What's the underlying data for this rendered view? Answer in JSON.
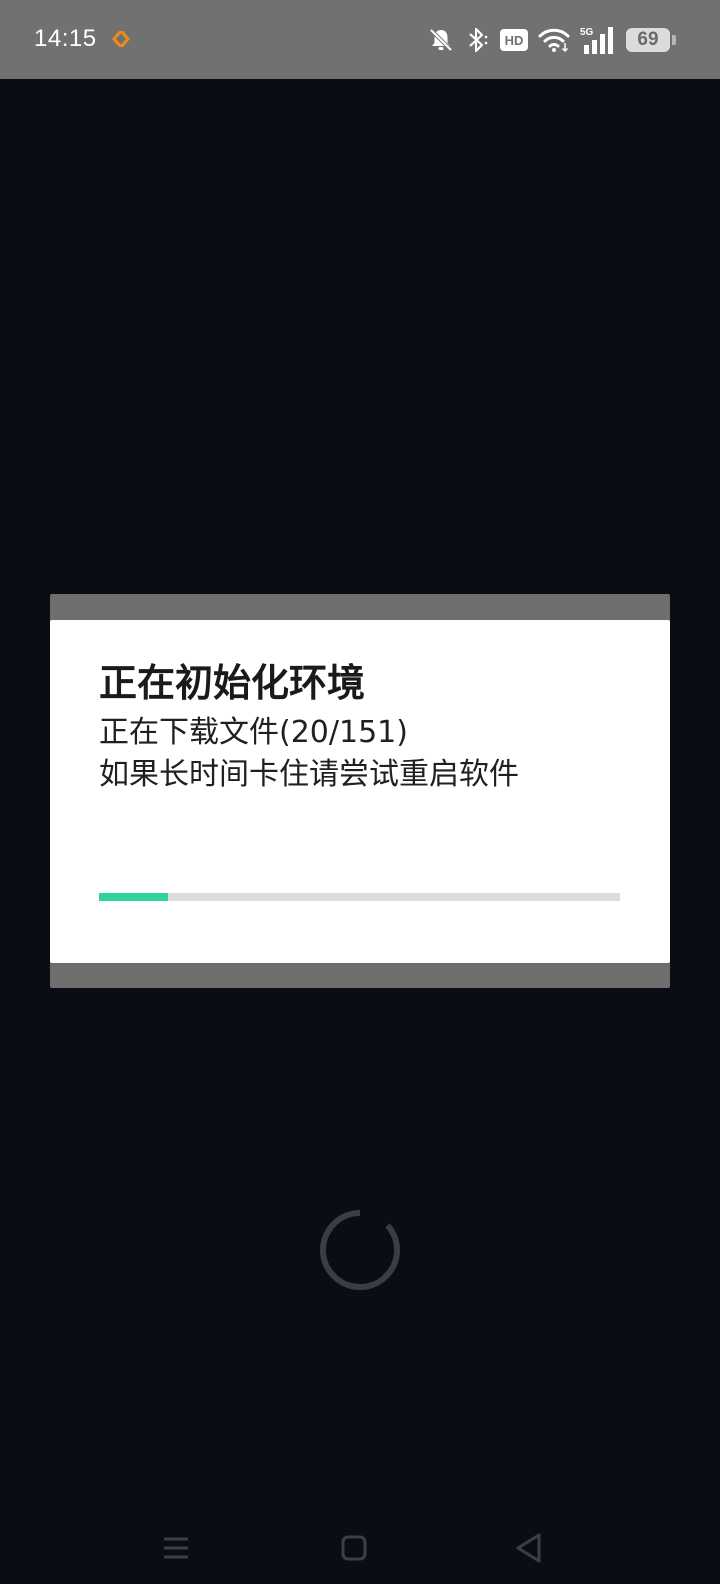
{
  "status_bar": {
    "time": "14:15",
    "battery_level": "69",
    "icons": [
      "app-notification-icon",
      "mute-icon",
      "bluetooth-icon",
      "hd-icon",
      "wifi-icon",
      "5g-signal-icon",
      "battery-icon"
    ]
  },
  "dialog": {
    "title": "正在初始化环境",
    "message_line1": "正在下载文件(20/151)",
    "message_line2": "如果长时间卡住请尝试重启软件",
    "progress_fraction": 0.1325
  },
  "loading": {
    "icon": "loading-spinner-icon"
  },
  "nav_bar": {
    "buttons": [
      "menu-icon",
      "home-icon",
      "back-icon"
    ]
  },
  "colors": {
    "progress_accent": "#2fd49c",
    "background": "#0b0d15",
    "status_bar_bg": "#717171"
  }
}
